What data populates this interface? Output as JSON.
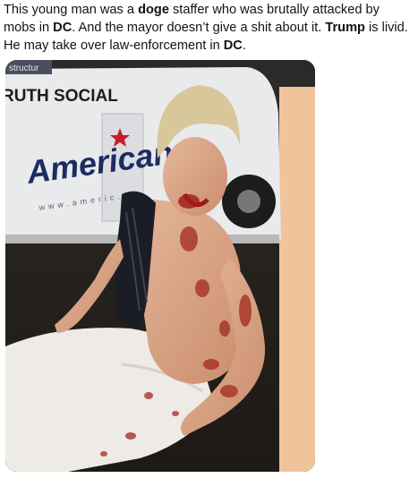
{
  "post": {
    "segments": [
      {
        "text": "This young man was a ",
        "bold": false
      },
      {
        "text": "doge",
        "bold": true
      },
      {
        "text": " staffer who was brutally attacked by mobs in ",
        "bold": false
      },
      {
        "text": "DC",
        "bold": true
      },
      {
        "text": ". And the mayor doesn’t give a shit about it. ",
        "bold": false
      },
      {
        "text": "Trump",
        "bold": true
      },
      {
        "text": " is livid. He may take over law-enforcement in ",
        "bold": false
      },
      {
        "text": "DC",
        "bold": true
      },
      {
        "text": ".",
        "bold": false
      }
    ]
  },
  "media": {
    "corner_text": "structur",
    "banner_text": "RUTH SOCIAL",
    "van_logo": "American",
    "van_url": "www.americ..."
  },
  "colors": {
    "text": "#0f1419",
    "background": "#ffffff",
    "van": "#e9eaec",
    "logo_navy": "#1c2c63",
    "logo_star": "#c4202b"
  }
}
